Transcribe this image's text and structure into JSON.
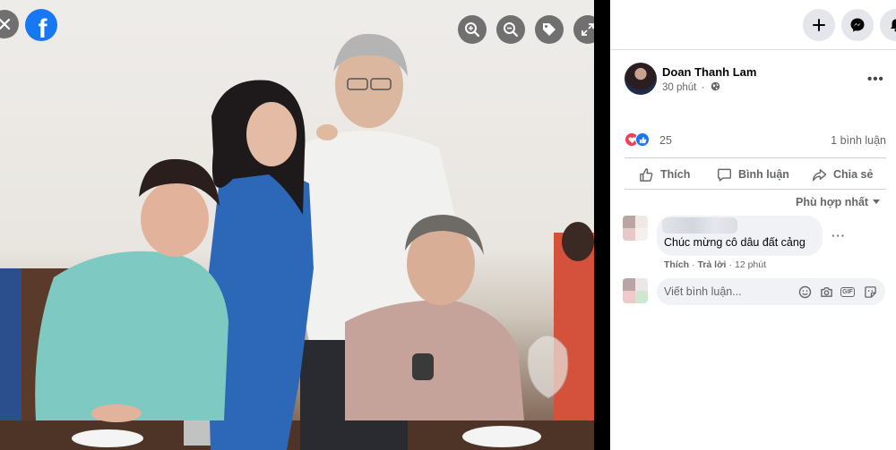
{
  "viewer": {
    "fb_logo_letter": "f",
    "toolbar": [
      "zoom-in-icon",
      "zoom-out-icon",
      "tag-icon",
      "expand-icon"
    ]
  },
  "topbar": {
    "icons": [
      "plus-icon",
      "messenger-icon",
      "bell-icon"
    ]
  },
  "post": {
    "author": "Doan Thanh Lam",
    "time": "30 phút",
    "privacy_icon": "globe-icon",
    "reaction_count": "25",
    "comment_count": "1 bình luận",
    "actions": {
      "like": "Thích",
      "comment": "Bình luận",
      "share": "Chia sẻ"
    },
    "sort_label": "Phù hợp nhất"
  },
  "comment": {
    "text": "Chúc mừng cô dâu đất cảng",
    "like_label": "Thích",
    "reply_label": "Trả lời",
    "time": "12 phút"
  },
  "composer": {
    "placeholder": "Viết bình luận...",
    "icons": [
      "emoji-icon",
      "camera-icon",
      "gif-icon",
      "sticker-icon"
    ]
  },
  "colors": {
    "facebook_blue": "#1877f2",
    "love_red": "#f33e58",
    "secondary_text": "#65676b",
    "bubble_bg": "#f0f2f5"
  }
}
